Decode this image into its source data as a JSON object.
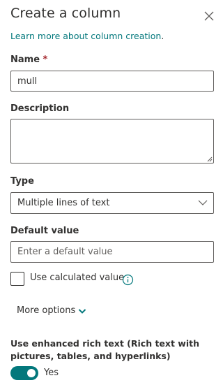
{
  "panel": {
    "title": "Create a column",
    "learn_more_link": "Learn more about column creation",
    "learn_more_suffix": "."
  },
  "name_field": {
    "label": "Name",
    "required_marker": "*",
    "value": "mull"
  },
  "description_field": {
    "label": "Description",
    "value": ""
  },
  "type_field": {
    "label": "Type",
    "selected": "Multiple lines of text"
  },
  "default_value_field": {
    "label": "Default value",
    "placeholder": "Enter a default value"
  },
  "calculated": {
    "label": "Use calculated value",
    "checked": false
  },
  "more_options": {
    "label": "More options"
  },
  "rich_text": {
    "label": "Use enhanced rich text (Rich text with pictures, tables, and hyperlinks)",
    "toggle_state": "Yes",
    "enabled": true
  },
  "colors": {
    "accent": "#03787c",
    "required": "#a4262c",
    "text": "#323130",
    "border": "#605e5c"
  },
  "icons": {
    "close": "close-icon",
    "dropdown": "chevron-down-icon",
    "info": "info-icon"
  }
}
